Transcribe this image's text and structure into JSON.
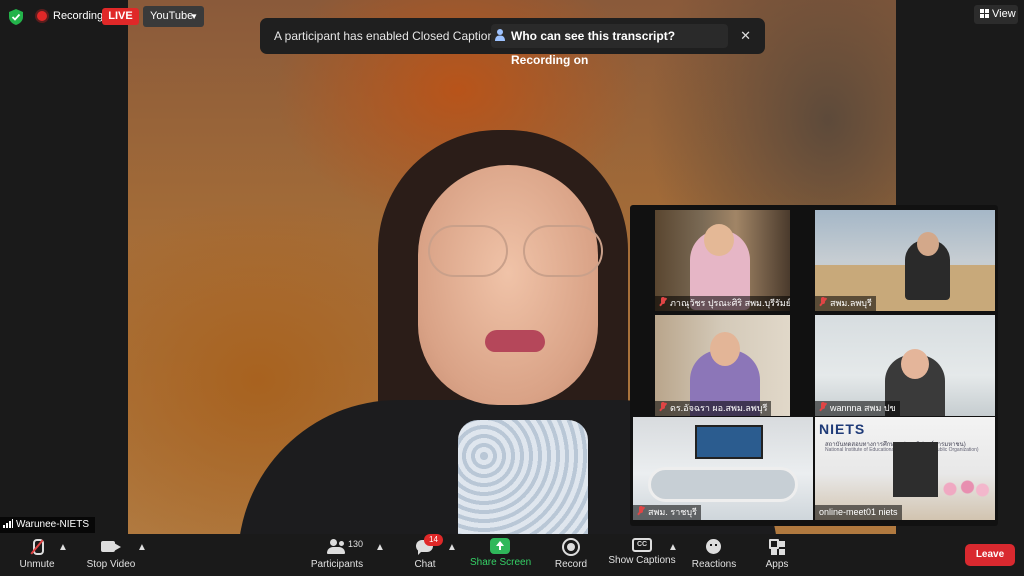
{
  "top_bar": {
    "recording_label": "Recording",
    "live_label": "LIVE",
    "stream_target": "YouTube",
    "view_label": "View",
    "recording_color": "#e02828",
    "encryption_icon": "shield-check-icon"
  },
  "banner": {
    "message": "A participant has enabled Closed Captioning",
    "link": "Who can see this transcript? Recording on",
    "close": "✕"
  },
  "main_speaker": {
    "name": "Warunee-NIETS"
  },
  "gallery": {
    "tiles": [
      {
        "name": "ภาณุวัชร ปุรณะศิริ สพม.บุรีรัมย์",
        "muted": true
      },
      {
        "name": "สพม.ลพบุรี",
        "muted": true
      },
      {
        "name": "ดร.อัจฉรา ผอ.สพม.ลพบุรี",
        "muted": true
      },
      {
        "name": "wannna สพม ปข",
        "muted": true
      },
      {
        "name": "สพม. ราชบุรี",
        "muted": true
      },
      {
        "name": "online-meet01 niets",
        "muted": false
      }
    ],
    "logo_text": "NIETS",
    "logo_sub_th": "สถาบันทดสอบทางการศึกษาแห่งชาติ (องค์การมหาชน)",
    "logo_sub_en": "National Institute of Educational Testing Service (Public Organization)"
  },
  "toolbar": {
    "unmute": "Unmute",
    "stop_video": "Stop Video",
    "participants": "Participants",
    "participant_count": "130",
    "chat": "Chat",
    "chat_badge": "14",
    "share_screen": "Share Screen",
    "record": "Record",
    "show_captions": "Show Captions",
    "cc_label": "CC",
    "reactions": "Reactions",
    "apps": "Apps",
    "leave": "Leave",
    "leave_color": "#d9292f",
    "share_color": "#35d066"
  }
}
